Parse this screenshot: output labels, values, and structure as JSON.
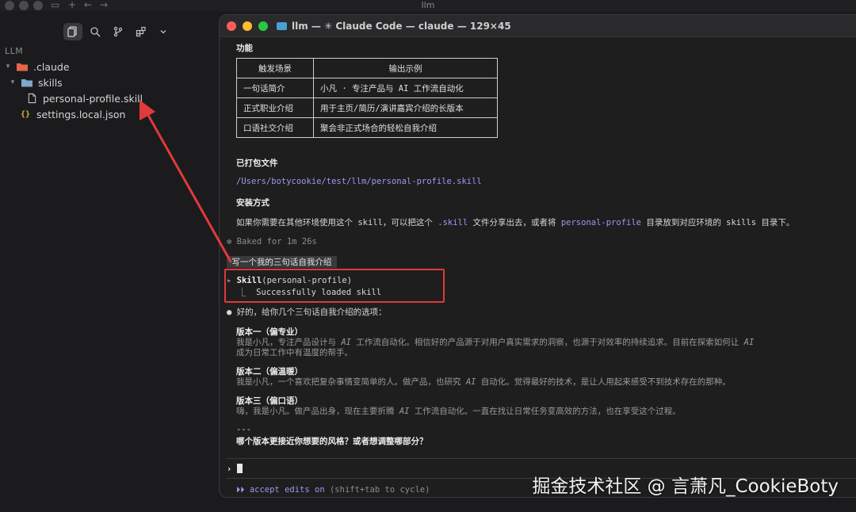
{
  "outer_window": {
    "title": "llm"
  },
  "sidebar": {
    "section_label": "LLM",
    "tree": [
      {
        "label": ".claude",
        "type": "folder",
        "expanded": true
      },
      {
        "label": "skills",
        "type": "folder",
        "expanded": true
      },
      {
        "label": "personal-profile.skill",
        "type": "file"
      },
      {
        "label": "settings.local.json",
        "type": "json"
      }
    ],
    "json_icon_text": "{}"
  },
  "terminal": {
    "title": "llm — ✳ Claude Code — claude — 129×45",
    "section_feature": "功能",
    "table": {
      "headers": [
        "触发场景",
        "输出示例"
      ],
      "rows": [
        [
          "一句话简介",
          "小凡 · 专注产品与 AI 工作流自动化"
        ],
        [
          "正式职业介绍",
          "用于主页/简历/演讲嘉宾介绍的长版本"
        ],
        [
          "口语社交介绍",
          "聚会非正式场合的轻松自我介绍"
        ]
      ]
    },
    "packaged_heading": "已打包文件",
    "packaged_path": "/Users/botycookie/test/llm/personal-profile.skill",
    "install_heading": "安装方式",
    "install_text_1": "如果你需要在其他环境使用这个 skill，可以把这个 ",
    "install_code_1": ".skill",
    "install_text_2": " 文件分享出去，或者将 ",
    "install_code_2": "personal-profile",
    "install_text_3": " 目录放到对应环境的 skills 目录下。",
    "baked": "✻ Baked for 1m 26s",
    "user_prompt": " 写一个我的三句话自我介绍 ",
    "skill_call_name": "Skill",
    "skill_call_arg": "(personal-profile)",
    "skill_result": "⎿  Successfully loaded skill",
    "reply_intro": "● 好的，给你几个三句话自我介绍的选项：",
    "versions": [
      {
        "title": "版本一（偏专业）",
        "lines": [
          [
            "我是小凡，专注产品设计与 ",
            "AI",
            " 工作流自动化。相信好的产品源于对用户真实需求的洞察，也源于对效率的持续追求。目前在探索如何让 ",
            "AI"
          ],
          [
            "成为日常工作中有温度的帮手。"
          ]
        ]
      },
      {
        "title": "版本二（偏温暖）",
        "lines": [
          [
            "我是小凡，一个喜欢把复杂事情变简单的人。做产品，也研究 ",
            "AI",
            " 自动化。觉得最好的技术，是让人用起来感受不到技术存在的那种。"
          ]
        ]
      },
      {
        "title": "版本三（偏口语）",
        "lines": [
          [
            "嗨，我是小凡。做产品出身，现在主要折腾 ",
            "AI",
            " 工作流自动化。一直在找让日常任务变高效的方法，也在享受这个过程。"
          ]
        ]
      }
    ],
    "divider": "---",
    "question": "哪个版本更接近你想要的风格？或者想调整哪部分？",
    "input_prompt": "›",
    "mode_arrows": "⏵⏵",
    "mode_label": "accept edits on",
    "mode_hint": "(shift+tab to cycle)"
  },
  "watermark": "掘金技术社区 @ 言萧凡_CookieBoty",
  "colors": {
    "annotation_red": "#e03a3a",
    "folder_orange": "#e7654b",
    "folder_blue": "#4b9fd6",
    "path_purple": "#9a9af0"
  }
}
